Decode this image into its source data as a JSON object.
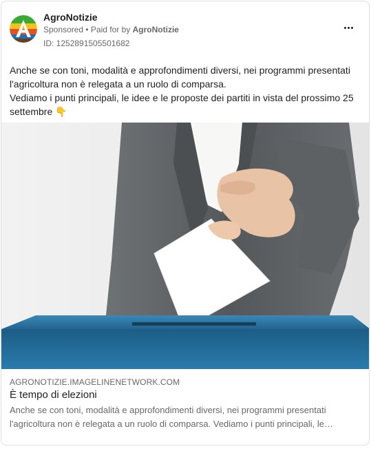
{
  "post": {
    "page_name": "AgroNotizie",
    "sponsored_label": "Sponsored",
    "separator": " • ",
    "paid_for_prefix": "Paid for by ",
    "paid_for_name": "AgroNotizie",
    "ad_id": "ID: 1252891505501682",
    "menu_icon": "more-horizontal-icon",
    "body_text": "Anche se con toni, modalità e approfondimenti diversi, nei programmi presentati l'agricoltura non è relegata a un ruolo di comparsa.\nVediamo i punti principali, le idee e le proposte dei partiti in vista del prossimo 25 settembre 👇"
  },
  "link": {
    "domain": "AGRONOTIZIE.IMAGELINENETWORK.COM",
    "title": "È tempo di elezioni",
    "description_line1": "Anche se con toni, modalità e approfondimenti diversi, nei programmi presentati",
    "description_line2": "l'agricoltura non è relegata a un ruolo di comparsa. Vediamo i punti principali, le…"
  },
  "colors": {
    "text_primary": "#1c1e21",
    "text_secondary": "#65676b",
    "logo_green": "#3aa935",
    "logo_blue": "#1e6fb8",
    "ballot_box_blue": "#1f6c97"
  }
}
